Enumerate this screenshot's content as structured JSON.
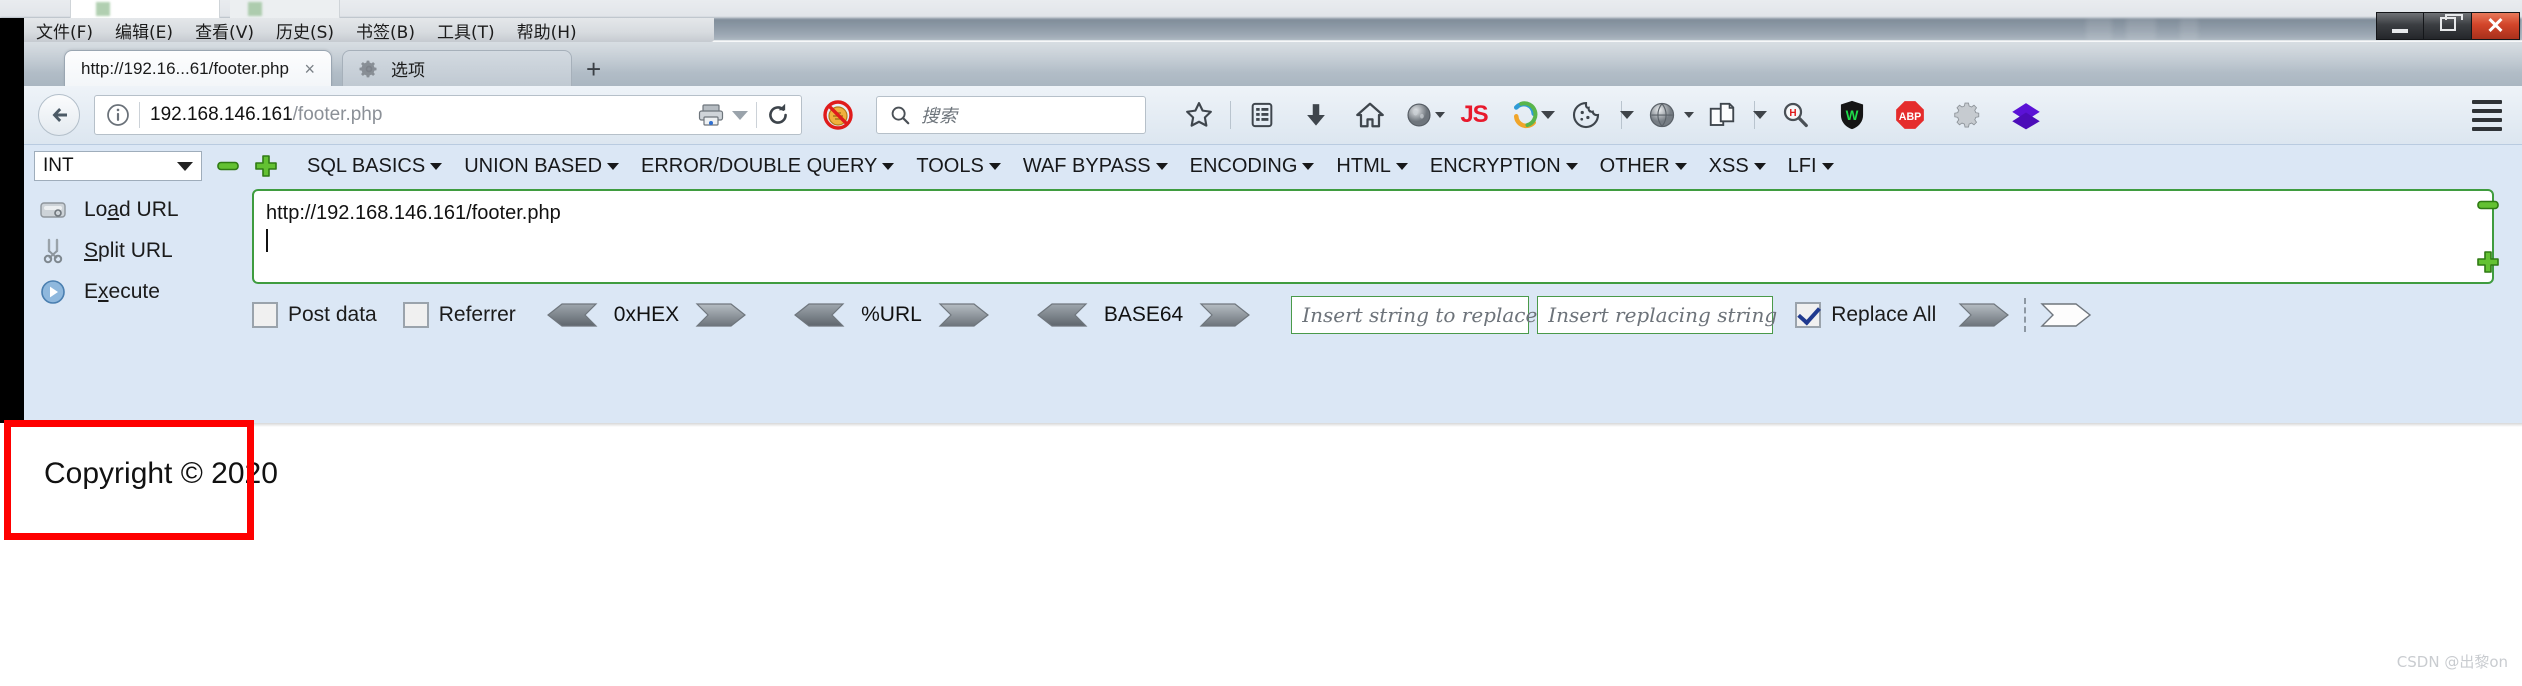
{
  "window": {
    "minimize_label": "Minimize",
    "maximize_label": "Maximize",
    "close_label": "Close"
  },
  "menubar": {
    "items": [
      {
        "name": "file",
        "text": "文件(F)",
        "accel": "F"
      },
      {
        "name": "edit",
        "text": "编辑(E)",
        "accel": "E"
      },
      {
        "name": "view",
        "text": "查看(V)",
        "accel": "V"
      },
      {
        "name": "history",
        "text": "历史(S)",
        "accel": "S"
      },
      {
        "name": "bookmarks",
        "text": "书签(B)",
        "accel": "B"
      },
      {
        "name": "tools",
        "text": "工具(T)",
        "accel": "T"
      },
      {
        "name": "help",
        "text": "帮助(H)",
        "accel": "H"
      }
    ]
  },
  "tabs": {
    "active": {
      "title": "http://192.16...61/footer.php",
      "close": "×",
      "icon": "none"
    },
    "inactive": {
      "title": "选项",
      "close": "×",
      "icon": "gear-icon"
    },
    "new_tab": "+"
  },
  "navbar": {
    "back_icon": "back-arrow-icon",
    "identity_icon": "info-circle-icon",
    "url_prefix": "192.168.146.161",
    "url_suffix": "/footer.php",
    "url_full": "192.168.146.161/footer.php",
    "reader_icon": "printer-icon",
    "reload_icon": "reload-icon",
    "noscript_icon": "noscript-blocked-icon",
    "search_placeholder": "搜索",
    "search_icon": "search-icon",
    "icons": [
      {
        "name": "bookmark-star-icon",
        "glyph": "star"
      },
      {
        "name": "library-icon",
        "glyph": "library"
      },
      {
        "name": "downloads-icon",
        "glyph": "download"
      },
      {
        "name": "home-icon",
        "glyph": "home"
      },
      {
        "name": "user-agent-icon",
        "glyph": "sphere"
      },
      {
        "name": "javascript-toggle-icon",
        "glyph": "JS"
      },
      {
        "name": "firebug-icon",
        "glyph": "swirl"
      },
      {
        "name": "cookie-manager-icon",
        "glyph": "cookie"
      },
      {
        "name": "proxy-icon",
        "glyph": "sphere2"
      },
      {
        "name": "copy-page-icon",
        "glyph": "pages"
      },
      {
        "name": "hackbar-search-icon",
        "glyph": "magnifier-h"
      },
      {
        "name": "wappalyzer-icon",
        "glyph": "shield-w"
      },
      {
        "name": "adblock-plus-icon",
        "glyph": "ABP"
      },
      {
        "name": "settings-gear-icon",
        "glyph": "gear"
      },
      {
        "name": "tamper-data-icon",
        "glyph": "diamond"
      }
    ],
    "menu_icon": "hamburger-menu-icon"
  },
  "hackbar": {
    "type_select": {
      "value": "INT",
      "caret": "▼"
    },
    "remove_icon": "minus-green-icon",
    "add_icon": "plus-green-icon",
    "menu": [
      {
        "name": "sql-basics",
        "label": "SQL BASICS"
      },
      {
        "name": "union-based",
        "label": "UNION BASED"
      },
      {
        "name": "error-double-query",
        "label": "ERROR/DOUBLE QUERY"
      },
      {
        "name": "tools",
        "label": "TOOLS"
      },
      {
        "name": "waf-bypass",
        "label": "WAF BYPASS"
      },
      {
        "name": "encoding",
        "label": "ENCODING"
      },
      {
        "name": "html",
        "label": "HTML"
      },
      {
        "name": "encryption",
        "label": "ENCRYPTION"
      },
      {
        "name": "other",
        "label": "OTHER"
      },
      {
        "name": "xss",
        "label": "XSS"
      },
      {
        "name": "lfi",
        "label": "LFI"
      }
    ],
    "buttons": [
      {
        "name": "load-url",
        "label": "Load URL",
        "accel": "a",
        "icon": "load-url-icon"
      },
      {
        "name": "split-url",
        "label": "Split URL",
        "accel": "S",
        "icon": "scissors-icon"
      },
      {
        "name": "execute",
        "label": "Execute",
        "accel": "x",
        "icon": "execute-play-icon"
      }
    ],
    "url_textarea": {
      "value": "http://192.168.146.161/footer.php",
      "line2": ""
    },
    "side_controls": [
      {
        "name": "collapse-hackbar-icon",
        "glyph": "minus"
      },
      {
        "name": "expand-hackbar-icon",
        "glyph": "plus"
      }
    ],
    "post_data": {
      "label": "Post data",
      "checked": false
    },
    "referrer": {
      "label": "Referrer",
      "checked": false
    },
    "encoders": [
      {
        "name": "hex",
        "label": "0xHEX"
      },
      {
        "name": "url",
        "label": "%URL"
      },
      {
        "name": "base64",
        "label": "BASE64"
      }
    ],
    "replace": {
      "search_placeholder": "Insert string to replace",
      "replace_placeholder": "Insert replacing string",
      "replace_all_label": "Replace All",
      "replace_all_checked": true
    }
  },
  "page": {
    "copyright": "Copyright © 2020"
  },
  "annotation": {
    "box_color": "#fe0000",
    "name": "highlight-box"
  },
  "watermark": {
    "text": "CSDN @出黎on"
  },
  "colors": {
    "hackbar_bg": "#dbe7f5",
    "navbar_bg": "#e3ecf5",
    "accent_green": "#3f9c3f",
    "annotation_red": "#fe0000"
  }
}
